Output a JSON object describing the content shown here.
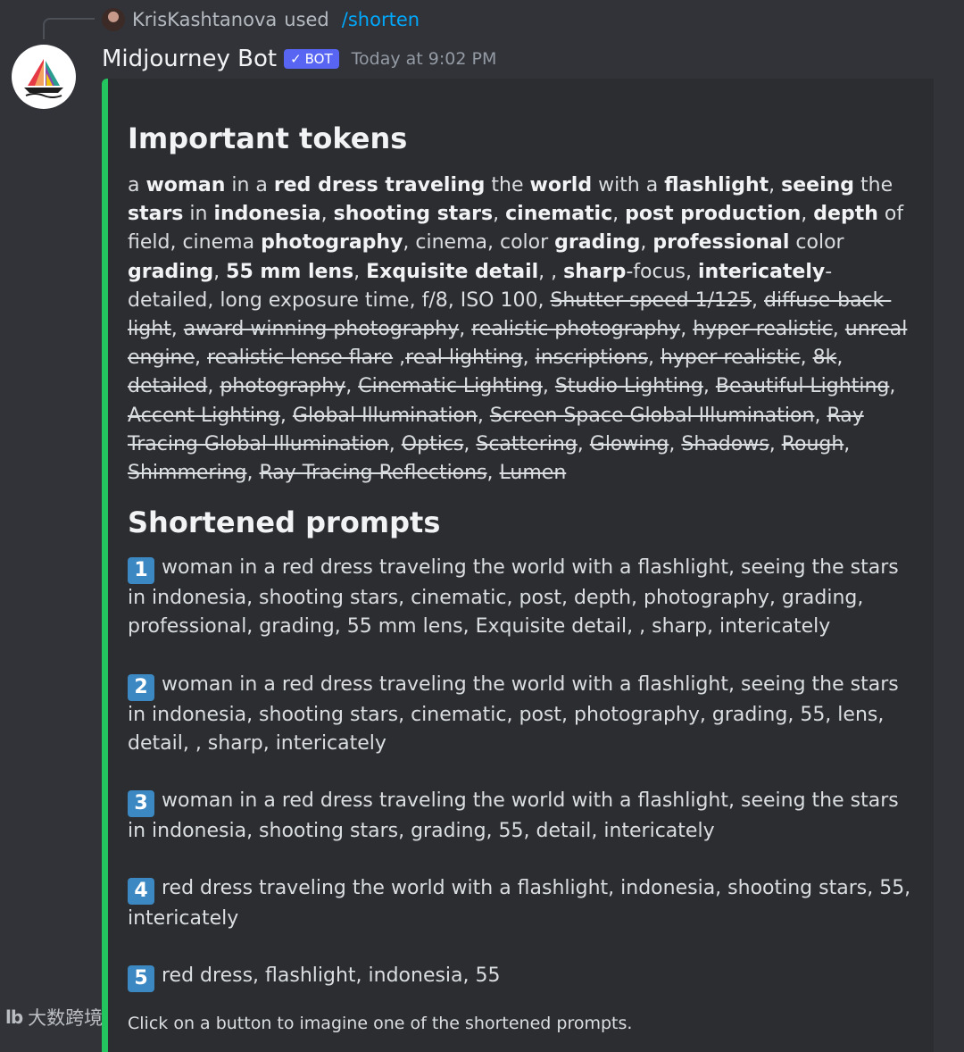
{
  "reply": {
    "user": "KrisKashtanova",
    "used": "used",
    "command": "/shorten"
  },
  "message": {
    "username": "Midjourney Bot",
    "badge": "BOT",
    "timestamp": "Today at 9:02 PM"
  },
  "colors": {
    "embed_accent": "#22c55e",
    "bot_badge": "#5865f2",
    "command_link": "#00a8fc",
    "number_badge": "#3b88c3"
  },
  "important_tokens": {
    "heading": "Important tokens",
    "segments": [
      {
        "t": "a ",
        "s": "n"
      },
      {
        "t": "woman",
        "s": "b"
      },
      {
        "t": " in a ",
        "s": "n"
      },
      {
        "t": "red dress traveling",
        "s": "b"
      },
      {
        "t": " the ",
        "s": "n"
      },
      {
        "t": "world",
        "s": "b"
      },
      {
        "t": " with a ",
        "s": "n"
      },
      {
        "t": "flashlight",
        "s": "b"
      },
      {
        "t": ", ",
        "s": "n"
      },
      {
        "t": "seeing",
        "s": "b"
      },
      {
        "t": " the ",
        "s": "n"
      },
      {
        "t": "stars",
        "s": "b"
      },
      {
        "t": " in ",
        "s": "n"
      },
      {
        "t": "indonesia",
        "s": "b"
      },
      {
        "t": ", ",
        "s": "n"
      },
      {
        "t": "shooting stars",
        "s": "b"
      },
      {
        "t": ", ",
        "s": "n"
      },
      {
        "t": "cinematic",
        "s": "b"
      },
      {
        "t": ", ",
        "s": "n"
      },
      {
        "t": "post production",
        "s": "b"
      },
      {
        "t": ", ",
        "s": "n"
      },
      {
        "t": "depth",
        "s": "b"
      },
      {
        "t": " of field, cinema ",
        "s": "n"
      },
      {
        "t": "photography",
        "s": "b"
      },
      {
        "t": ", cinema, color ",
        "s": "n"
      },
      {
        "t": "grading",
        "s": "b"
      },
      {
        "t": ", ",
        "s": "n"
      },
      {
        "t": "professional",
        "s": "b"
      },
      {
        "t": " color ",
        "s": "n"
      },
      {
        "t": "grading",
        "s": "b"
      },
      {
        "t": ", ",
        "s": "n"
      },
      {
        "t": "55 mm lens",
        "s": "b"
      },
      {
        "t": ", ",
        "s": "n"
      },
      {
        "t": "Exquisite detail",
        "s": "b"
      },
      {
        "t": ", , ",
        "s": "n"
      },
      {
        "t": "sharp",
        "s": "b"
      },
      {
        "t": "-focus, ",
        "s": "n"
      },
      {
        "t": "intericately",
        "s": "b"
      },
      {
        "t": "-detailed, long exposure time, f/8, ISO 100, ",
        "s": "n"
      },
      {
        "t": "Shutter speed 1/125",
        "s": "s"
      },
      {
        "t": ", ",
        "s": "n"
      },
      {
        "t": "diffuse-back-light",
        "s": "s"
      },
      {
        "t": ", ",
        "s": "n"
      },
      {
        "t": "award winning photography",
        "s": "s"
      },
      {
        "t": ", ",
        "s": "n"
      },
      {
        "t": "realistic photography",
        "s": "s"
      },
      {
        "t": ", ",
        "s": "n"
      },
      {
        "t": "hyper realistic",
        "s": "s"
      },
      {
        "t": ", ",
        "s": "n"
      },
      {
        "t": "unreal engine",
        "s": "s"
      },
      {
        "t": ", ",
        "s": "n"
      },
      {
        "t": "realistic lense flare",
        "s": "s"
      },
      {
        "t": " ,",
        "s": "n"
      },
      {
        "t": "real lighting",
        "s": "s"
      },
      {
        "t": ", ",
        "s": "n"
      },
      {
        "t": "inscriptions",
        "s": "s"
      },
      {
        "t": ", ",
        "s": "n"
      },
      {
        "t": "hyper realistic",
        "s": "s"
      },
      {
        "t": ", ",
        "s": "n"
      },
      {
        "t": "8k",
        "s": "s"
      },
      {
        "t": ", ",
        "s": "n"
      },
      {
        "t": "detailed",
        "s": "s"
      },
      {
        "t": ", ",
        "s": "n"
      },
      {
        "t": "photography",
        "s": "s"
      },
      {
        "t": ", ",
        "s": "n"
      },
      {
        "t": "Cinematic Lighting",
        "s": "s"
      },
      {
        "t": ", ",
        "s": "n"
      },
      {
        "t": "Studio Lighting",
        "s": "s"
      },
      {
        "t": ", ",
        "s": "n"
      },
      {
        "t": "Beautiful Lighting",
        "s": "s"
      },
      {
        "t": ", ",
        "s": "n"
      },
      {
        "t": "Accent Lighting",
        "s": "s"
      },
      {
        "t": ", ",
        "s": "n"
      },
      {
        "t": "Global Illumination",
        "s": "s"
      },
      {
        "t": ", ",
        "s": "n"
      },
      {
        "t": "Screen Space Global Illumination",
        "s": "s"
      },
      {
        "t": ", ",
        "s": "n"
      },
      {
        "t": "Ray Tracing Global Illumination",
        "s": "s"
      },
      {
        "t": ", ",
        "s": "n"
      },
      {
        "t": "Optics",
        "s": "s"
      },
      {
        "t": ", ",
        "s": "n"
      },
      {
        "t": "Scattering",
        "s": "s"
      },
      {
        "t": ", ",
        "s": "n"
      },
      {
        "t": "Glowing",
        "s": "s"
      },
      {
        "t": ", ",
        "s": "n"
      },
      {
        "t": "Shadows",
        "s": "s"
      },
      {
        "t": ", ",
        "s": "n"
      },
      {
        "t": "Rough",
        "s": "s"
      },
      {
        "t": ", ",
        "s": "n"
      },
      {
        "t": "Shimmering",
        "s": "s"
      },
      {
        "t": ", ",
        "s": "n"
      },
      {
        "t": "Ray Tracing Reflections",
        "s": "s"
      },
      {
        "t": ", ",
        "s": "n"
      },
      {
        "t": "Lumen",
        "s": "s"
      }
    ]
  },
  "shortened": {
    "heading": "Shortened prompts",
    "prompts": [
      {
        "num": "1",
        "text": "woman in a red dress traveling the world with a flashlight, seeing the stars in indonesia, shooting stars, cinematic, post, depth, photography, grading, professional, grading, 55 mm lens, Exquisite detail, , sharp, intericately"
      },
      {
        "num": "2",
        "text": "woman in a red dress traveling the world with a flashlight, seeing the stars in indonesia, shooting stars, cinematic, post, photography, grading, 55, lens, detail, , sharp, intericately"
      },
      {
        "num": "3",
        "text": "woman in a red dress traveling the world with a flashlight, seeing the stars in indonesia, shooting stars, grading, 55, detail, intericately"
      },
      {
        "num": "4",
        "text": "red dress traveling the world with a flashlight, indonesia, shooting stars, 55, intericately"
      },
      {
        "num": "5",
        "text": "red dress, flashlight, indonesia, 55"
      }
    ],
    "footer": "Click on a button to imagine one of the shortened prompts."
  },
  "watermark": {
    "logo": "lb",
    "text": "大数跨境"
  }
}
